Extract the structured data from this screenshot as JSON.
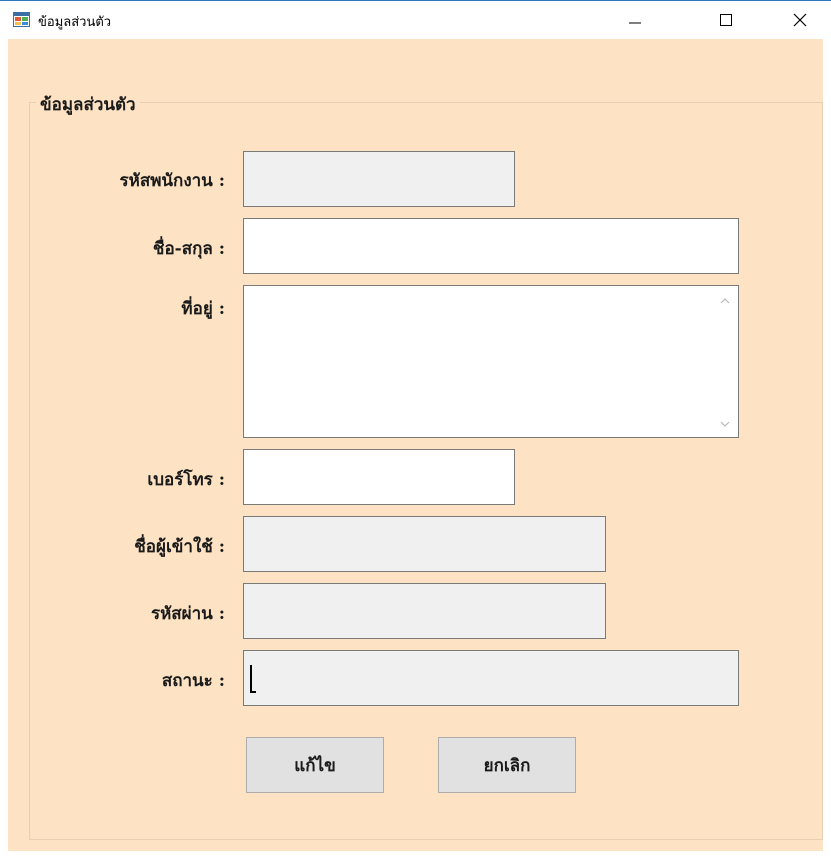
{
  "window": {
    "title": "ข้อมูลส่วนตัว",
    "icon": "app-window-icon",
    "controls": [
      "minimize-icon",
      "maximize-icon",
      "close-icon"
    ]
  },
  "group": {
    "title": "ข้อมูลส่วนตัว"
  },
  "fields": {
    "employee_id": {
      "label": "รหัสพนักงาน :",
      "value": ""
    },
    "full_name": {
      "label": "ชื่อ-สกุล :",
      "value": ""
    },
    "address": {
      "label": "ที่อยู่ :",
      "value": ""
    },
    "phone": {
      "label": "เบอร์โทร :",
      "value": ""
    },
    "username": {
      "label": "ชื่อผู้เข้าใช้ :",
      "value": ""
    },
    "password": {
      "label": "รหัสผ่าน :",
      "value": ""
    },
    "status": {
      "label": "สถานะ :",
      "value": ""
    }
  },
  "buttons": {
    "edit": "แก้ไข",
    "cancel": "ยกเลิก"
  },
  "colors": {
    "client_bg": "#fde3c4",
    "readonly_bg": "#f0f0f0",
    "button_bg": "#e1e1e1",
    "title_border": "#2b79c2"
  }
}
